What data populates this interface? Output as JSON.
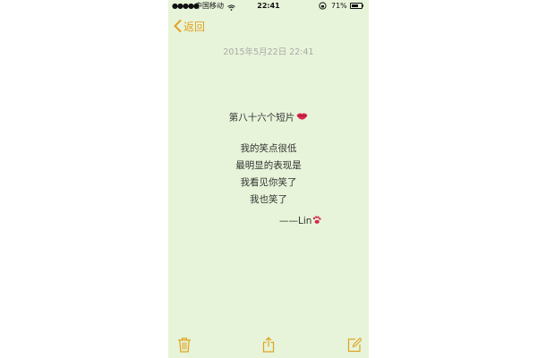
{
  "status_bar": {
    "signal": "●●●●●",
    "carrier": "中国移动",
    "time": "22:41",
    "battery_percent": "71%",
    "battery_level": 0.71
  },
  "nav": {
    "back_label": "返回"
  },
  "note": {
    "date": "2015年5月22日 22:41",
    "title": "第八十六个短片",
    "lines": [
      "我的笑点很低",
      "最明显的表现是",
      "我看见你笑了",
      "我也笑了"
    ],
    "signature": "——Lin"
  },
  "toolbar": {
    "items": [
      "trash-icon",
      "share-icon",
      "compose-icon"
    ]
  },
  "colors": {
    "accent": "#e0a31f",
    "background": "#e7f4d9",
    "text": "#333333",
    "date_text": "#a9a9a9"
  }
}
